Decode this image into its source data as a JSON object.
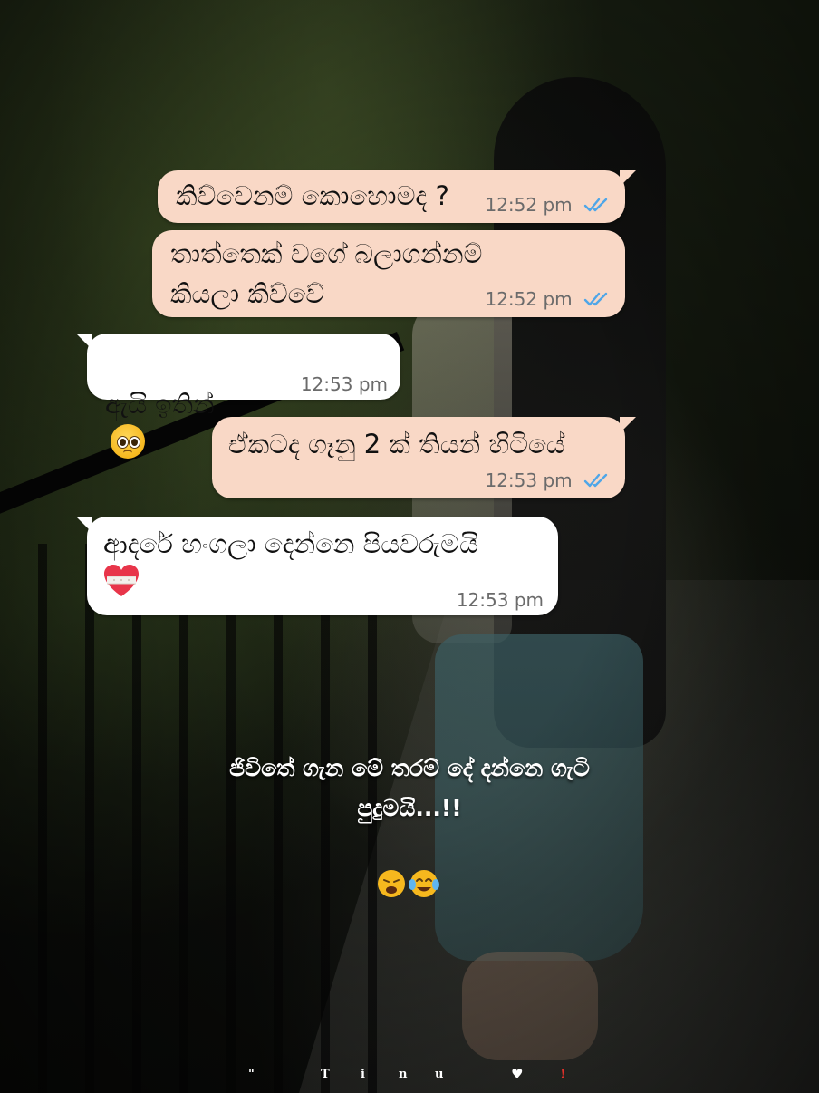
{
  "messages": [
    {
      "id": "m1",
      "direction": "outgoing",
      "text": "කිව්වෙනම් කොහොමද ?",
      "time": "12:52 pm",
      "status": "read"
    },
    {
      "id": "m2",
      "direction": "outgoing",
      "text": "තාත්තෙක් වගේ බලාගන්නම්\nකියලා කිව්වේ",
      "time": "12:52 pm",
      "status": "read"
    },
    {
      "id": "m3",
      "direction": "incoming",
      "text": "ඇයි ඉතින්",
      "emoji": "pleading-face-icon",
      "time": "12:53 pm"
    },
    {
      "id": "m4",
      "direction": "outgoing",
      "text": "ඒකටද ගෑනු 2 ක් තියන් හිටියේ",
      "time": "12:53 pm",
      "status": "read"
    },
    {
      "id": "m5",
      "direction": "incoming",
      "text": "ආදරේ හංගලා දෙන්නෙ පියවරුමයි",
      "emoji": "mending-heart-icon",
      "time": "12:53 pm"
    }
  ],
  "caption": {
    "line1": "ජිවිතේ ගැන මේ තරම් දේ දන්නෙ ගැටි",
    "line2": "පුදුමයි...!!",
    "emojis": [
      "weary-face-icon",
      "tears-of-joy-icon"
    ]
  },
  "footer": {
    "chars": [
      "\"",
      "T",
      "i",
      "n",
      "u",
      "♥",
      "!"
    ]
  },
  "colors": {
    "outgoing_bubble": "#f9d8c6",
    "incoming_bubble": "#ffffff",
    "read_ticks": "#4fa6e8",
    "time_text": "#6b6b6b"
  }
}
